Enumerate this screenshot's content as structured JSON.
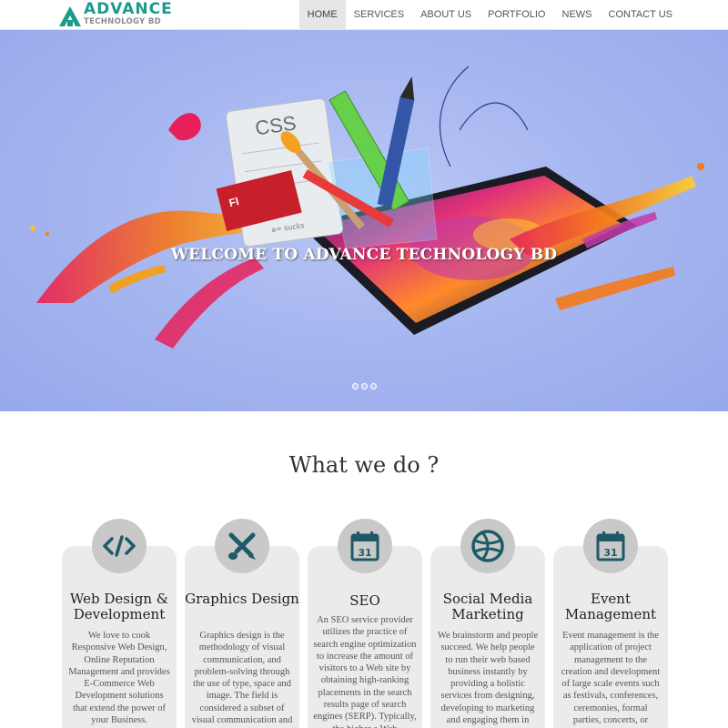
{
  "brand": {
    "name": "ADVANCE",
    "sub": "TECHNOLOGY BD",
    "color": "#1d9a8c"
  },
  "nav": {
    "items": [
      {
        "label": "HOME",
        "active": true
      },
      {
        "label": "SERVICES"
      },
      {
        "label": "ABOUT US"
      },
      {
        "label": "PORTFOLIO"
      },
      {
        "label": "NEWS"
      },
      {
        "label": "CONTACT US"
      }
    ]
  },
  "hero": {
    "title": "WELCOME TO ADVANCE TECHNOLOGY BD",
    "art_texts": {
      "css": "CSS",
      "fl": "Fl",
      "paper": "a= sucks"
    },
    "slides": 3
  },
  "services": {
    "title": "What we do ?",
    "icon_color": "#1d5a66",
    "cards": [
      {
        "title": "Web Design & Development",
        "icon": "code-icon",
        "text": "We love to cook Responsive Web Design, Online Reputation Management and provides E-Commerce Web Development solutions that extend the power of your Business."
      },
      {
        "title": "Graphics Design",
        "icon": "brush-pencil-icon",
        "text": "Graphics design is the methodology of visual communication, and problem-solving through the use of type, space and image. The field is considered a subset of visual communication and"
      },
      {
        "title": "SEO",
        "icon": "calendar-icon",
        "icon_label": "31",
        "text": "An SEO service provider utilizes the practice of search engine optimization to increase the amount of visitors to a Web site by obtaining high-ranking placements in the search results page of search engines (SERP). Typically, the higher a Web"
      },
      {
        "title": "Social Media Marketing",
        "icon": "globe-icon",
        "text": "We brainstorm and people succeed. We help people to run their web based business instantly by providing a holistic services from designing, developing to marketing and engaging them in"
      },
      {
        "title": "Event Management",
        "icon": "calendar-icon",
        "icon_label": "31",
        "text": "Event management is the application of project management to the creation and development of large scale events such as festivals, conferences, ceremonies, formal parties, concerts, or"
      }
    ]
  }
}
